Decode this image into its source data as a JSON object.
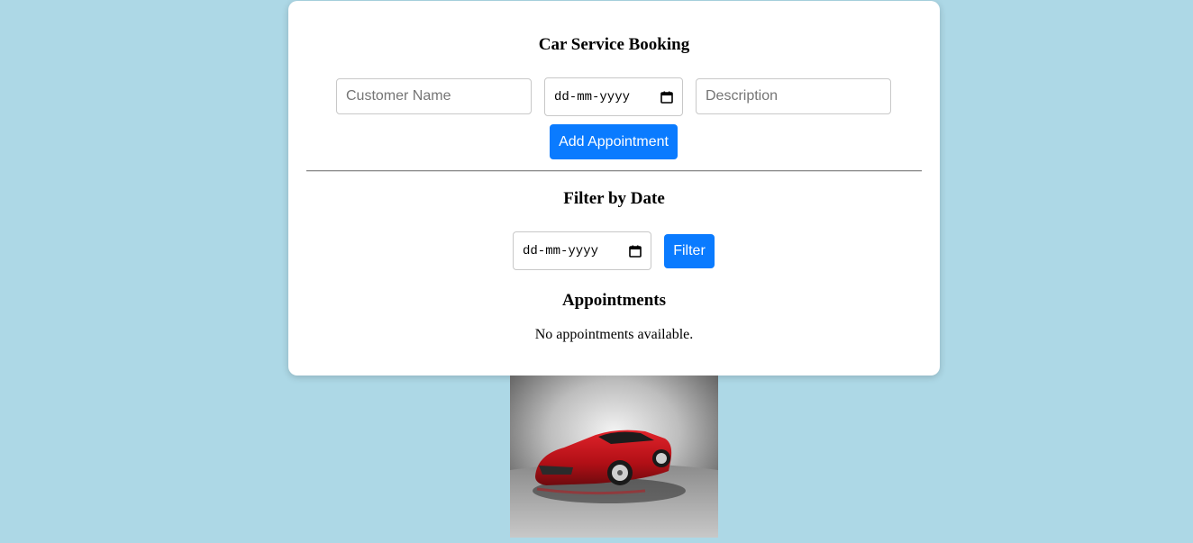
{
  "booking": {
    "title": "Car Service Booking",
    "customer_name_placeholder": "Customer Name",
    "date_placeholder": "dd-mm-yyyy",
    "description_placeholder": "Description",
    "add_button_label": "Add Appointment"
  },
  "filter": {
    "title": "Filter by Date",
    "date_placeholder": "dd-mm-yyyy",
    "button_label": "Filter"
  },
  "appointments": {
    "title": "Appointments",
    "empty_message": "No appointments available."
  },
  "colors": {
    "page_background": "#add8e6",
    "primary_button": "#0a7bff",
    "card_background": "#ffffff"
  },
  "icons": {
    "date_picker": "calendar-icon"
  }
}
